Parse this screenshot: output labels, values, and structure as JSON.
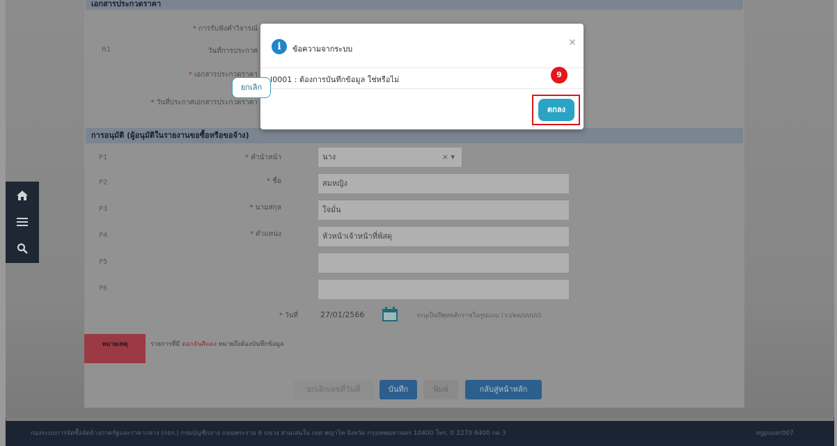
{
  "top_section": {
    "header": "เอกสารประกวดราคา",
    "row_r1": "R1",
    "label_receive": "การรับฟังคำวิจารณ์",
    "label_date": "วันที่การประกาศ",
    "label_doc": "เอกสารประกวดราคา",
    "label_doc_date": "วันที่ประกาศเอกสารประกวดราคา"
  },
  "approval_section": {
    "header": "การอนุมัติ (ผู้อนุมัติในรายงานขอซื้อหรือขอจ้าง)",
    "rows": [
      {
        "code": "P1",
        "label": "คำนำหน้า",
        "value": "นาง"
      },
      {
        "code": "P2",
        "label": "ชื่อ",
        "value": "สมหญิง"
      },
      {
        "code": "P3",
        "label": "นามสกุล",
        "value": "ใจมั่น"
      },
      {
        "code": "P4",
        "label": "ตำแหน่ง",
        "value": "หัวหน้าเจ้าหน้าที่พัสดุ"
      },
      {
        "code": "P5",
        "label": "",
        "value": ""
      },
      {
        "code": "P6",
        "label": "",
        "value": ""
      }
    ],
    "date_label": "วันที่",
    "date_value": "27/01/2566",
    "date_hint": "ระบุเป็นปีพุทธศักราชในรูปแบบ (วว/ดด/ปปปป)"
  },
  "note": {
    "tag": "หมายเหตุ",
    "text_prefix": "รายการที่มี ",
    "text_highlight": "ดอกจันสีแดง",
    "text_suffix": " หมายถึงต้องบันทึกข้อมูล"
  },
  "actions": {
    "cancel_number": "ยกเลิกเลขที่วันที่",
    "save": "บันทึก",
    "print": "พิมพ์",
    "back": "กลับสู่หน้าหลัก"
  },
  "dialog": {
    "title": "ข้อความจากระบบ",
    "close": "×",
    "message": "I0001 : ต้องการบันทึกข้อมูล ใช่หรือไม่",
    "cancel": "ยกเลิก",
    "ok": "ตกลง",
    "step_badge": "9"
  },
  "footer": {
    "text": "กองระบบการจัดซื้อจัดจ้างภาครัฐและราคากลาง (กจร.) กรมบัญชีกลาง ถนนพระราม 6 แขวง สามเสนใน เขต พญาไท จังหวัด กรุงเทพมหานคร 10400 โทร. 0 2270 6400 กด 3",
    "user": "egpuser007"
  },
  "colors": {
    "ok_button": "#2aa3c4",
    "highlight_border": "#d9141b",
    "badge": "#e4161b",
    "info_icon": "#1f86c8"
  }
}
